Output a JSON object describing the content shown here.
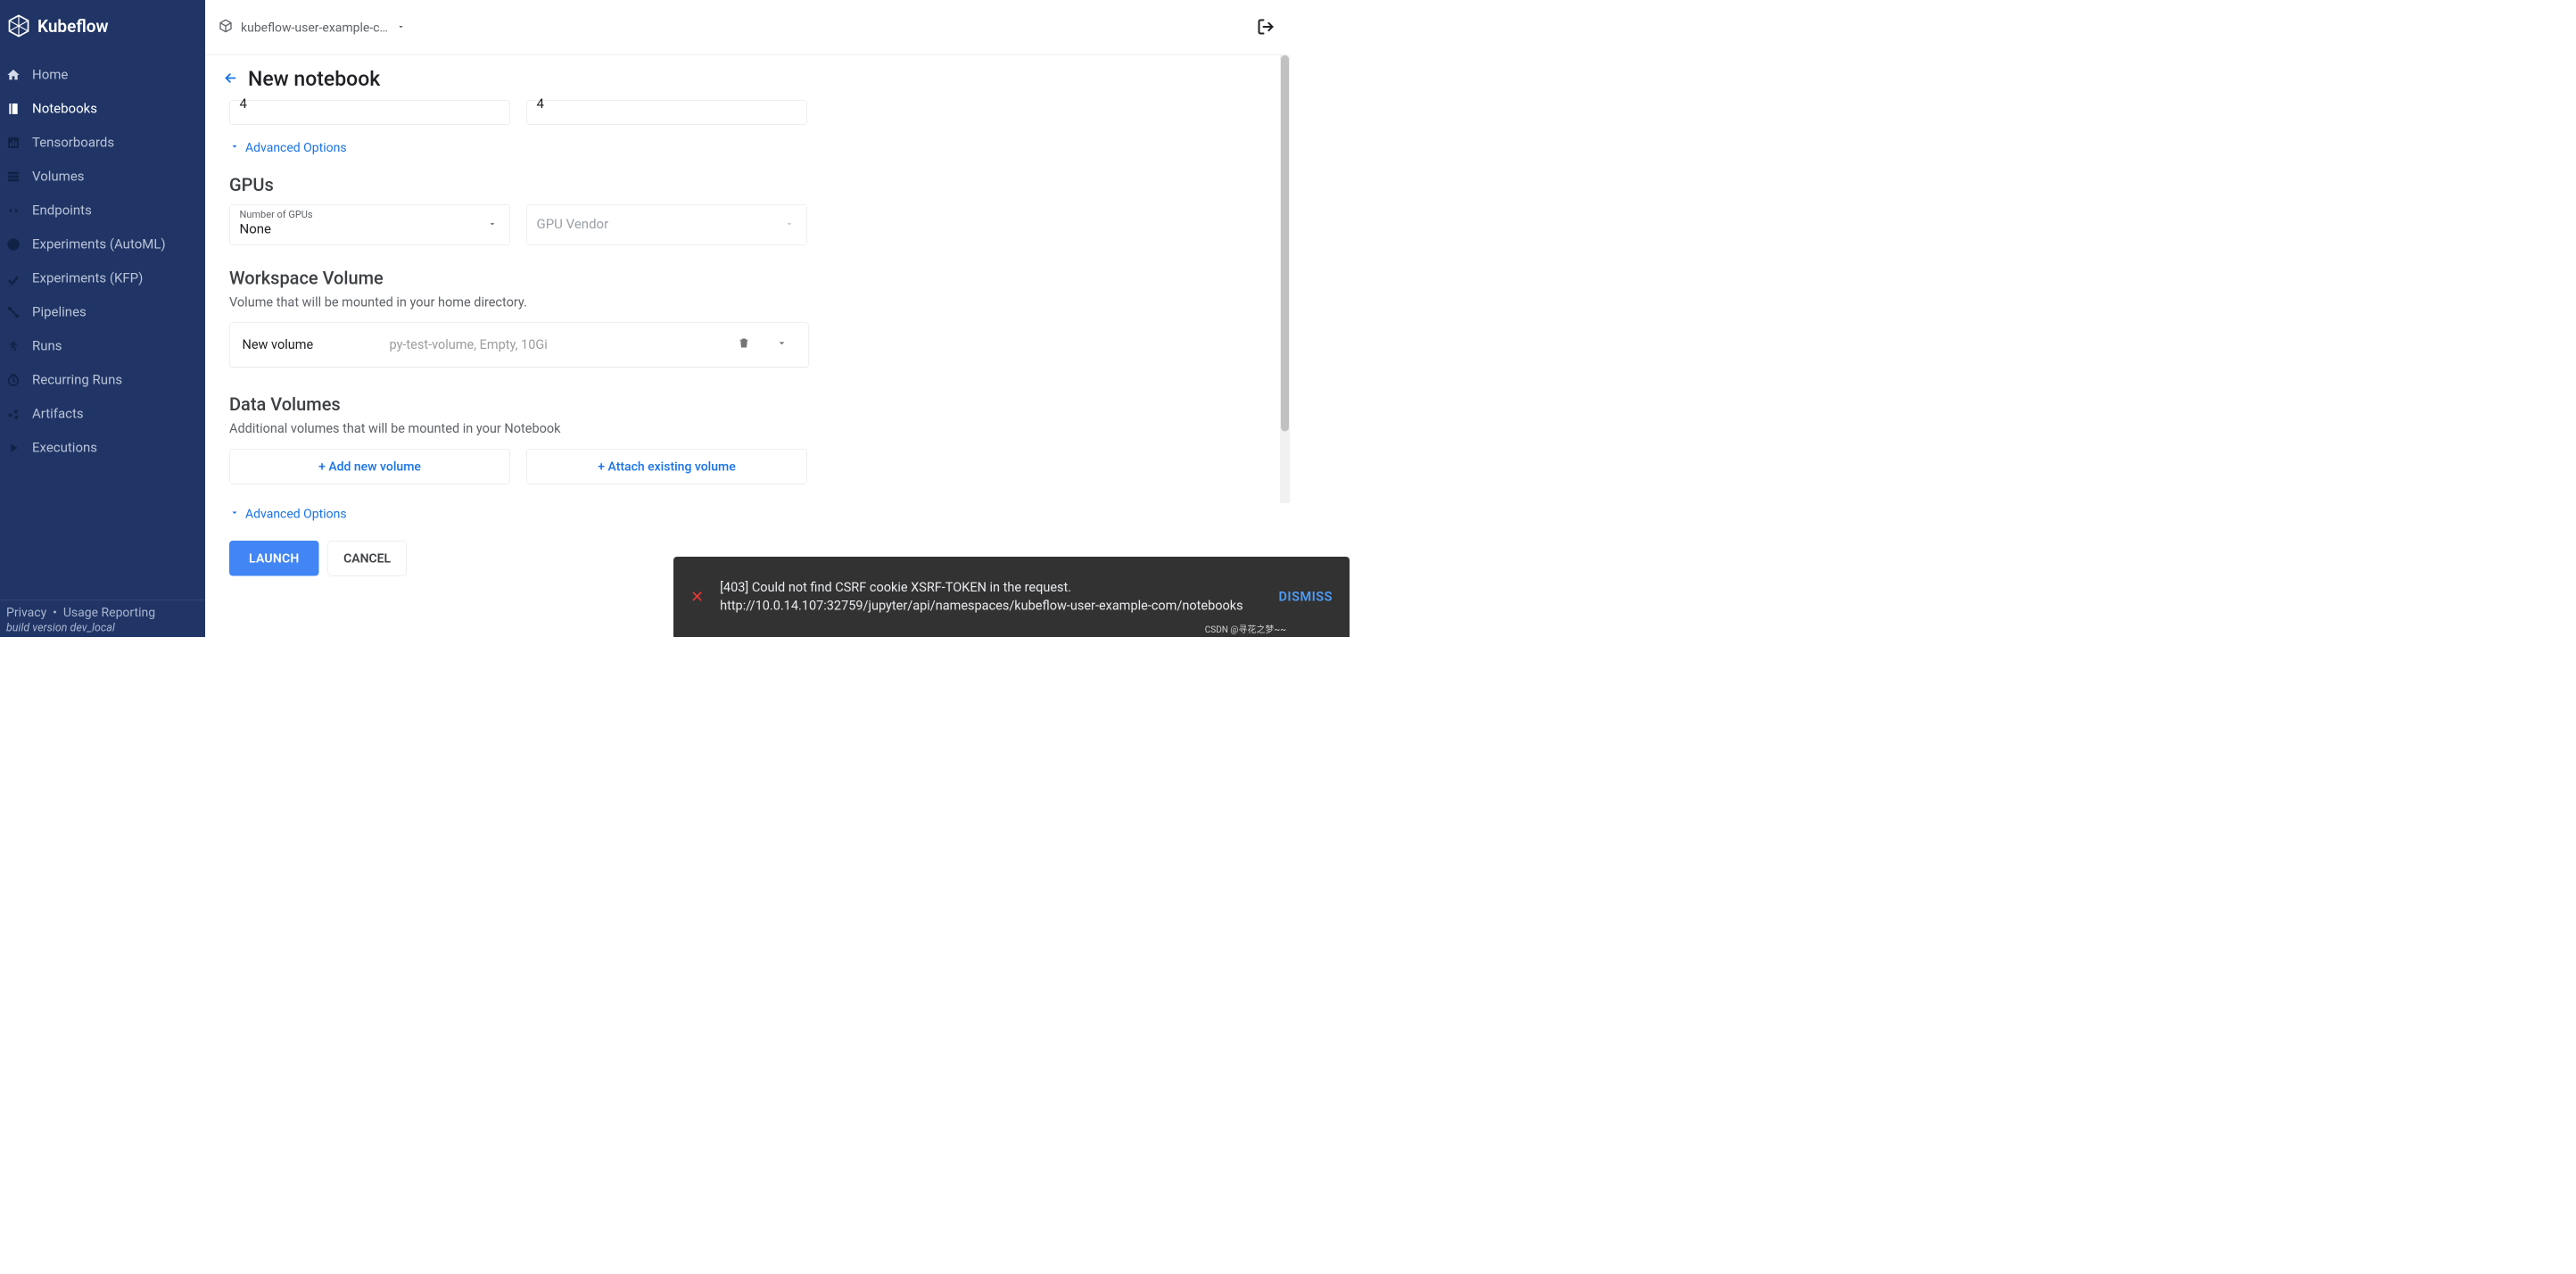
{
  "brand": {
    "name": "Kubeflow"
  },
  "sidebar": {
    "items": [
      {
        "label": "Home"
      },
      {
        "label": "Notebooks"
      },
      {
        "label": "Tensorboards"
      },
      {
        "label": "Volumes"
      },
      {
        "label": "Endpoints"
      },
      {
        "label": "Experiments (AutoML)"
      },
      {
        "label": "Experiments (KFP)"
      },
      {
        "label": "Pipelines"
      },
      {
        "label": "Runs"
      },
      {
        "label": "Recurring Runs"
      },
      {
        "label": "Artifacts"
      },
      {
        "label": "Executions"
      }
    ]
  },
  "footer": {
    "privacy": "Privacy",
    "usage": "Usage Reporting",
    "build": "build version dev_local"
  },
  "topbar": {
    "namespace": "kubeflow-user-example-c…"
  },
  "page": {
    "title": "New notebook"
  },
  "cpu": {
    "requested": "4",
    "limit": "4"
  },
  "adv_link": "Advanced Options",
  "gpus": {
    "title": "GPUs",
    "number_label": "Number of GPUs",
    "number_value": "None",
    "vendor_placeholder": "GPU Vendor"
  },
  "workspace": {
    "title": "Workspace Volume",
    "desc": "Volume that will be mounted in your home directory.",
    "new_volume_label": "New volume",
    "volume_summary": "py-test-volume,  Empty,  10Gi"
  },
  "datavol": {
    "title": "Data Volumes",
    "desc": "Additional volumes that will be mounted in your Notebook",
    "add_new": "+ Add new volume",
    "attach": "+ Attach existing volume"
  },
  "actions": {
    "launch": "LAUNCH",
    "cancel": "CANCEL"
  },
  "snackbar": {
    "message": "[403] Could not find CSRF cookie XSRF-TOKEN in the request. http://10.0.14.107:32759/jupyter/api/namespaces/kubeflow-user-example-com/notebooks",
    "dismiss": "DISMISS"
  },
  "watermark": "CSDN @寻花之梦~~"
}
